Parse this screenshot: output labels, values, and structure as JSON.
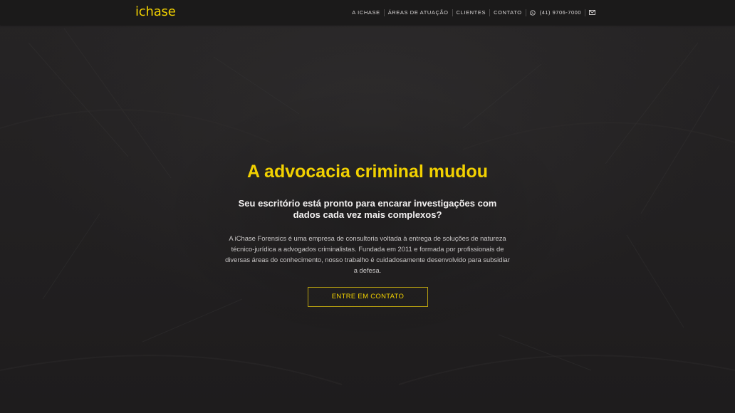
{
  "header": {
    "logo": "ichase",
    "nav": [
      {
        "label": "A iChase"
      },
      {
        "label": "Áreas de atuação"
      },
      {
        "label": "Clientes"
      },
      {
        "label": "Contato"
      }
    ],
    "phone": "(41) 9706-7000",
    "phone_icon": "whatsapp-icon",
    "mail_icon": "envelope-icon"
  },
  "hero": {
    "title": "A advocacia criminal mudou",
    "subtitle": "Seu escritório está pronto para encarar investigações com dados cada vez mais complexos?",
    "body": "A iChase Forensics é uma empresa de consultoria voltada à entrega de soluções de natureza técnico-jurídica a advogados criminalistas. Fundada em 2011 e formada por profissionais de diversas áreas do conhecimento, nosso trabalho é cuidadosamente desenvolvido para subsidiar a defesa.",
    "cta": "Entre em contato"
  },
  "colors": {
    "accent": "#f2d100",
    "background": "#1f1d1e",
    "header_bg": "#1b1a1a"
  }
}
